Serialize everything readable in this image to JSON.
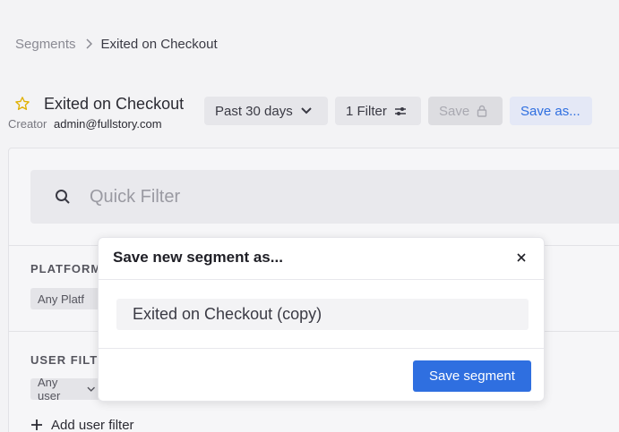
{
  "breadcrumb": {
    "parent": "Segments",
    "current": "Exited on Checkout"
  },
  "header": {
    "title": "Exited on Checkout",
    "creator_label": "Creator",
    "creator_value": "admin@fullstory.com"
  },
  "toolbar": {
    "date_range": "Past 30 days",
    "filter_count": "1 Filter",
    "save_label": "Save",
    "save_as_label": "Save as..."
  },
  "quick_filter": {
    "placeholder": "Quick Filter"
  },
  "sections": {
    "platform_label": "PLATFORM",
    "platform_chip": "Any Platf",
    "user_filters_label": "USER FILTE",
    "user_chip": "Any user",
    "add_user_filter": "Add user filter"
  },
  "modal": {
    "title": "Save new segment as...",
    "name_value": "Exited on Checkout (copy)",
    "save_button": "Save segment"
  },
  "colors": {
    "accent": "#2f6fe0",
    "star": "#e0b000"
  }
}
